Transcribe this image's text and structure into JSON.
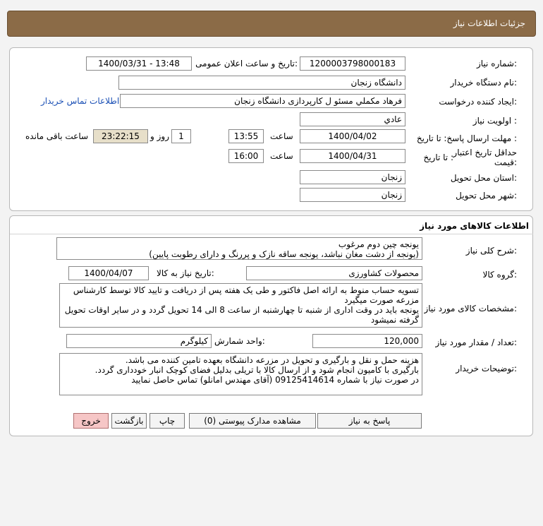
{
  "page": {
    "title": "جزئیات اطلاعات نیاز"
  },
  "general": {
    "need_number_label": "شماره نیاز:",
    "need_number": "1200003798000183",
    "announce_label": "تاریخ و ساعت اعلان عمومی:",
    "announce_value": "1400/03/31 - 13:48",
    "buyer_label": "نام دستگاه خریدار:",
    "buyer_value": "دانشگاه زنجان",
    "requester_label": "ایجاد کننده درخواست:",
    "requester_value": "فرهاد مکملي مسئو ل کارپردازی دانشگاه زنجان",
    "contact_link": "اطلاعات تماس خریدار",
    "priority_label": "اولویت نیاز :",
    "priority_value": "عادي",
    "deadline_label": "مهلت ارسال پاسخ: تا تاریخ :",
    "deadline_date": "1400/04/02",
    "time_label": "ساعت",
    "deadline_time": "13:55",
    "days_value": "1",
    "days_label": "روز و",
    "remaining_time": "23:22:15",
    "remaining_label": "ساعت باقی مانده",
    "validity_label_1": "حداقل تاریخ اعتبار",
    "validity_label_2": "قیمت:",
    "validity_to_label": "تا تاریخ :",
    "validity_date": "1400/04/31",
    "validity_time": "16:00",
    "province_label": "استان محل تحویل:",
    "province_value": "زنجان",
    "city_label": "شهر محل تحویل:",
    "city_value": "زنجان"
  },
  "goods": {
    "section_title": "اطلاعات کالاهای مورد نیاز",
    "summary_label": "شرح کلی نیاز:",
    "summary_line1": "یونجه چین دوم مرغوب",
    "summary_line2": "(یونجه از دشت مغان نباشد، یونجه ساقه نازک و پررنگ و دارای رطوبت پایین)",
    "group_label": "گروه کالا:",
    "group_value": "محصولات کشاورزی",
    "need_date_label": "تاریخ نیاز به کالا:",
    "need_date_value": "1400/04/07",
    "specs_label": "مشخصات کالای مورد نیاز:",
    "specs_line1": "تسویه حساب منوط به ارائه اصل فاکتور و طی یک هفته پس از دریافت و تایید کالا توسط کارشناس مزرعه صورت میگیرد",
    "specs_line2": "یونجه باید در وقت اداری از شنبه تا چهارشنبه از ساعت 8 الی 14 تحویل گردد و در سایر اوقات تحویل گرفته نمیشود",
    "qty_label": "تعداد / مقدار مورد نیاز:",
    "qty_value": "120,000",
    "unit_label": "واحد شمارش:",
    "unit_value": "کیلوگرم",
    "buyer_notes_label": "توضیحات خریدار:",
    "notes_line1": "هزینه حمل و نقل و بارگیری و تحویل در مزرعه دانشگاه بعهده تامین کننده می باشد.",
    "notes_line2": "بارگیری با کامیون انجام شود و از ارسال کالا با تریلی بدلیل فضای کوچک انبار خودداری گردد.",
    "notes_line3": "در صورت نیاز با شماره 09125414614 (آقای مهندس امانلو) تماس حاصل نمایید"
  },
  "buttons": {
    "reply": "پاسخ به نیاز",
    "attachments": "مشاهده مدارک پیوستی (0)",
    "print": "چاپ",
    "back": "بازگشت",
    "exit": "خروج"
  }
}
